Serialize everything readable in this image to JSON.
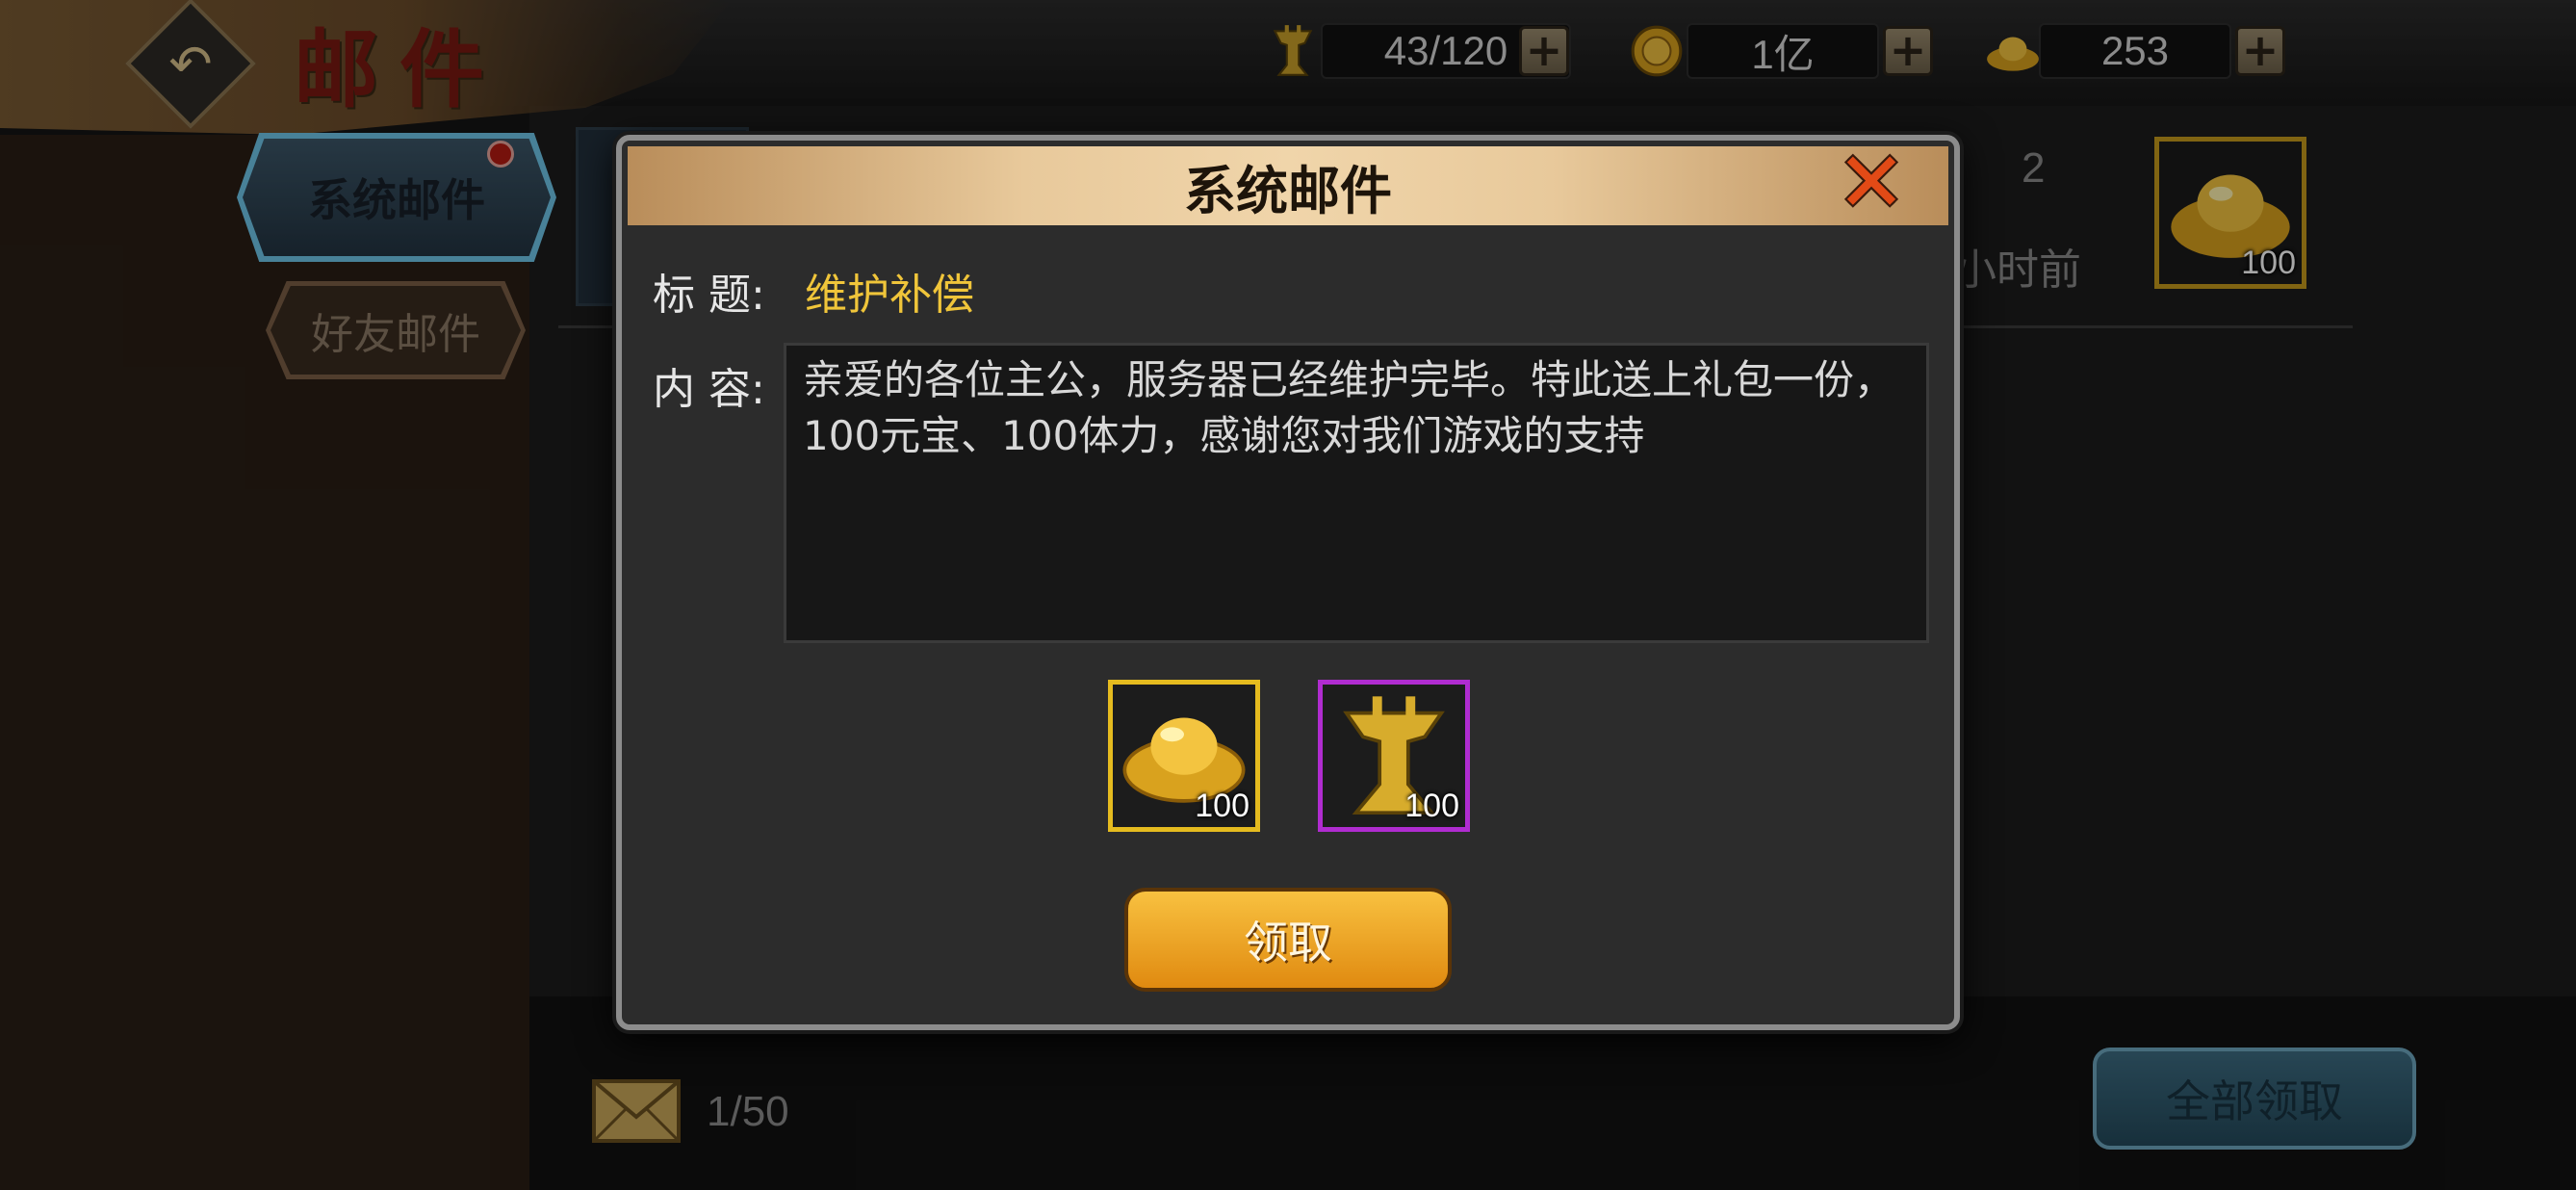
{
  "header": {
    "title": "邮件",
    "currencies": [
      {
        "icon": "jue-vessel-icon",
        "value": "43/120"
      },
      {
        "icon": "copper-coin-icon",
        "value": "1亿"
      },
      {
        "icon": "gold-ingot-icon",
        "value": "253"
      }
    ]
  },
  "tabs": [
    {
      "label": "系统邮件",
      "active": true,
      "has_notification": true
    },
    {
      "label": "好友邮件",
      "active": false
    }
  ],
  "list_item": {
    "count_fragment": "2",
    "time_fragment": "小时前",
    "reward": {
      "icon": "gold-ingot-icon",
      "count": "100"
    }
  },
  "footer": {
    "mail_count": "1/50",
    "claim_all_label": "全部领取"
  },
  "dialog": {
    "title": "系统邮件",
    "subject_label": "标 题:",
    "subject_value": "维护补偿",
    "content_label": "内 容:",
    "content_text": "亲爱的各位主公，服务器已经维护完毕。特此送上礼包一份，100元宝、100体力，感谢您对我们游戏的支持",
    "rewards": [
      {
        "icon": "gold-ingot-icon",
        "count": "100",
        "rarity_color": "#e5bb1f"
      },
      {
        "icon": "jue-vessel-icon",
        "count": "100",
        "rarity_color": "#b02cd0"
      }
    ],
    "claim_label": "领取"
  },
  "colors": {
    "accent_gold": "#f0c53a",
    "tab_active": "#6fc7ea",
    "close_red": "#e24a16"
  }
}
